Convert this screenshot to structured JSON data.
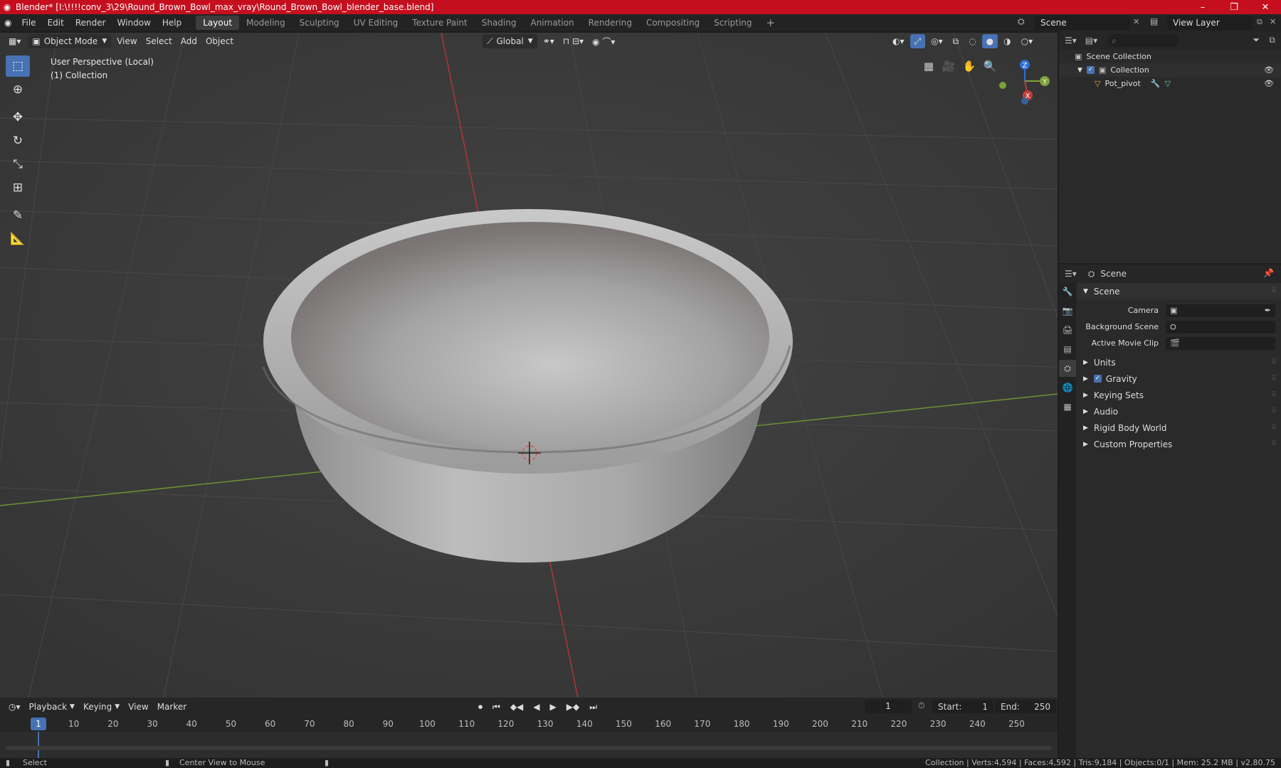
{
  "window": {
    "title": "Blender* [I:\\!!!!conv_3\\29\\Round_Brown_Bowl_max_vray\\Round_Brown_Bowl_blender_base.blend]",
    "minimize": "–",
    "maximize": "❐",
    "close": "✕"
  },
  "menu": [
    "File",
    "Edit",
    "Render",
    "Window",
    "Help"
  ],
  "workspaces": [
    "Layout",
    "Modeling",
    "Sculpting",
    "UV Editing",
    "Texture Paint",
    "Shading",
    "Animation",
    "Rendering",
    "Compositing",
    "Scripting"
  ],
  "active_workspace": "Layout",
  "add_workspace": "+",
  "scene_name": "Scene",
  "view_layer": "View Layer",
  "viewport": {
    "mode": "Object Mode",
    "menus": [
      "View",
      "Select",
      "Add",
      "Object"
    ],
    "transform_orientation": "Global",
    "overlay_line1": "User Perspective (Local)",
    "overlay_line2": "(1) Collection",
    "gizmo": {
      "z": "Z",
      "y": "Y",
      "x": "X"
    },
    "tools": [
      "select-box",
      "cursor",
      "move",
      "rotate",
      "scale",
      "transform",
      "annotate",
      "measure"
    ]
  },
  "timeline": {
    "menus": [
      "Playback",
      "Keying",
      "View",
      "Marker"
    ],
    "current_frame": "1",
    "start_label": "Start:",
    "start": "1",
    "end_label": "End:",
    "end": "250",
    "ticks": [
      "1",
      "10",
      "20",
      "30",
      "40",
      "50",
      "60",
      "70",
      "80",
      "90",
      "100",
      "110",
      "120",
      "130",
      "140",
      "150",
      "160",
      "170",
      "180",
      "190",
      "200",
      "210",
      "220",
      "230",
      "240",
      "250"
    ]
  },
  "status": {
    "left": "Select",
    "middle": "Center View to Mouse",
    "right": "Collection | Verts:4,594 | Faces:4,592 | Tris:9,184 | Objects:0/1 | Mem: 25.2 MB | v2.80.75"
  },
  "outliner": {
    "root": "Scene Collection",
    "collection": "Collection",
    "object": "Pot_pivot"
  },
  "properties": {
    "context": "Scene",
    "panel": "Scene",
    "fields": [
      {
        "label": "Camera",
        "value": ""
      },
      {
        "label": "Background Scene",
        "value": ""
      },
      {
        "label": "Active Movie Clip",
        "value": ""
      }
    ],
    "sections": [
      "Units",
      "Gravity",
      "Keying Sets",
      "Audio",
      "Rigid Body World",
      "Custom Properties"
    ]
  },
  "colors": {
    "title_bar": "#c50f1f",
    "accent": "#4772b3",
    "viewport_bg": "#3b3b3b",
    "x_axis": "#c23c3c",
    "y_axis": "#7ba23a"
  }
}
